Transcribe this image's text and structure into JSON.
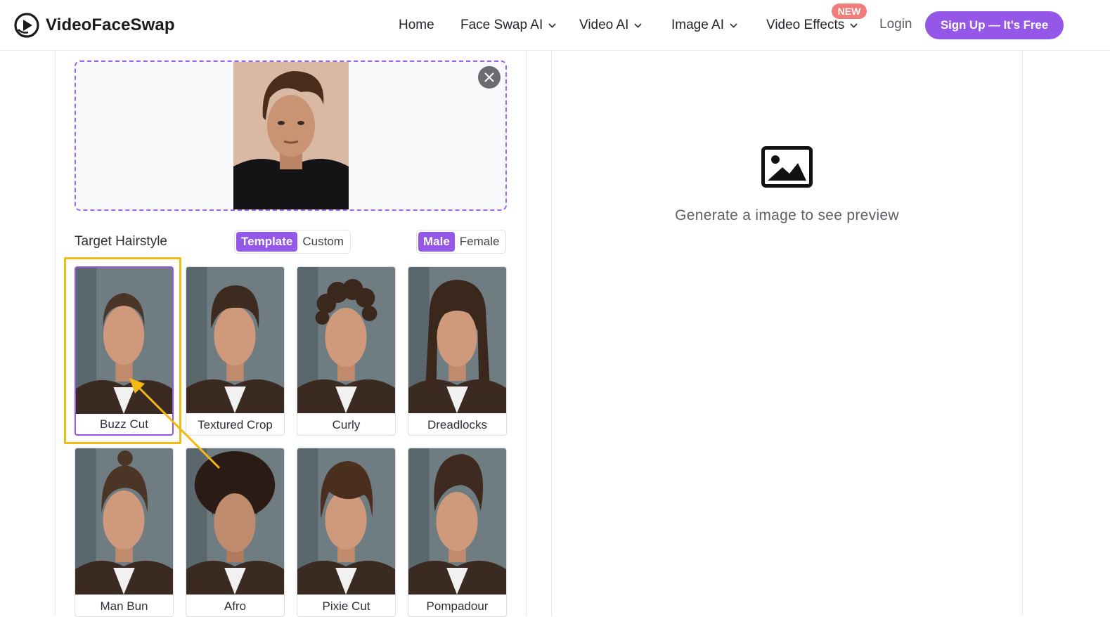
{
  "header": {
    "brand": "VideoFaceSwap",
    "nav": [
      {
        "label": "Home"
      },
      {
        "label": "Face Swap AI"
      },
      {
        "label": "Video AI"
      },
      {
        "label": "Image AI"
      },
      {
        "label": "Video Effects"
      }
    ],
    "new_badge": "NEW",
    "login": "Login",
    "signup": "Sign Up — It's Free"
  },
  "editor": {
    "target_label": "Target Hairstyle",
    "mode_tabs": [
      {
        "label": "Template",
        "active": true
      },
      {
        "label": "Custom",
        "active": false
      }
    ],
    "gender_tabs": [
      {
        "label": "Male",
        "active": true
      },
      {
        "label": "Female",
        "active": false
      }
    ],
    "hairstyles": [
      {
        "label": "Buzz Cut",
        "selected": true
      },
      {
        "label": "Textured Crop",
        "selected": false
      },
      {
        "label": "Curly",
        "selected": false
      },
      {
        "label": "Dreadlocks",
        "selected": false
      },
      {
        "label": "Man Bun",
        "selected": false
      },
      {
        "label": "Afro",
        "selected": false
      },
      {
        "label": "Pixie Cut",
        "selected": false
      },
      {
        "label": "Pompadour",
        "selected": false
      }
    ]
  },
  "preview": {
    "placeholder": "Generate a image to see preview"
  },
  "colors": {
    "accent": "#9457e8",
    "highlight": "#f5b914",
    "badge": "#f27b7b"
  }
}
